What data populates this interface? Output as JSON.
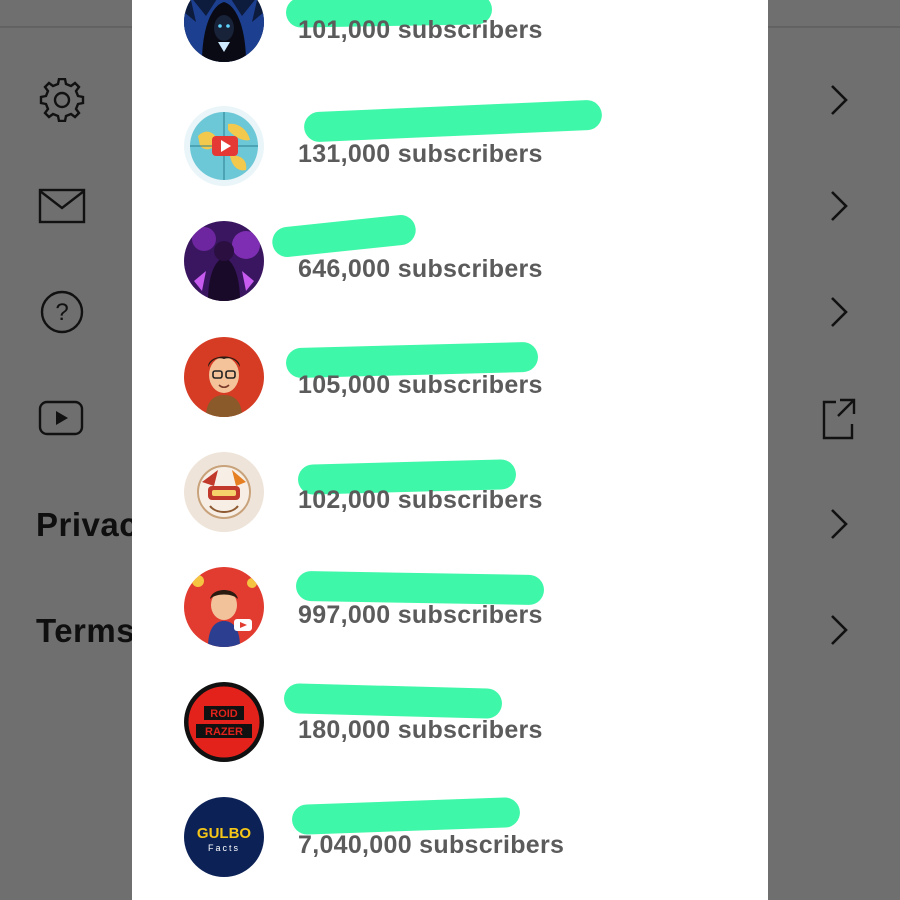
{
  "background": {
    "rows": [
      {
        "icon": "gear-icon",
        "label": "",
        "action": "chevron-right-icon"
      },
      {
        "icon": "mail-icon",
        "label": "",
        "action": "chevron-right-icon"
      },
      {
        "icon": "help-icon",
        "label": "",
        "action": "chevron-right-icon"
      },
      {
        "icon": "youtube-icon",
        "label": "",
        "action": "external-link-icon"
      },
      {
        "icon": "",
        "label": "Privac",
        "action": "chevron-right-icon"
      },
      {
        "icon": "",
        "label": "Terms",
        "action": "chevron-right-icon"
      }
    ]
  },
  "channels": [
    {
      "subscribers": "101,000 subscribers",
      "avatar": "hooded-figure-avatar",
      "name_redacted": true
    },
    {
      "subscribers": "131,000 subscribers",
      "avatar": "globe-play-avatar",
      "name_redacted": true
    },
    {
      "subscribers": "646,000 subscribers",
      "avatar": "purple-character-avatar",
      "name_redacted": true
    },
    {
      "subscribers": "105,000 subscribers",
      "avatar": "cartoon-boy-avatar",
      "name_redacted": true
    },
    {
      "subscribers": "102,000 subscribers",
      "avatar": "food-logo-avatar",
      "name_redacted": true
    },
    {
      "subscribers": "997,000 subscribers",
      "avatar": "gamer-avatar",
      "name_redacted": true
    },
    {
      "subscribers": "180,000 subscribers",
      "avatar": "roid-razer-avatar",
      "avatar_text": [
        "ROID",
        "RAZER"
      ],
      "name_redacted": true
    },
    {
      "subscribers": "7,040,000 subscribers",
      "avatar": "gulbo-facts-avatar",
      "avatar_text": [
        "GULBO",
        "Facts"
      ],
      "name_redacted": true
    }
  ],
  "colors": {
    "redaction": "#3ff7a8",
    "overlay_background": "#6f6f6f",
    "modal_background": "#ffffff",
    "subscriber_text": "#5b5b5b"
  }
}
